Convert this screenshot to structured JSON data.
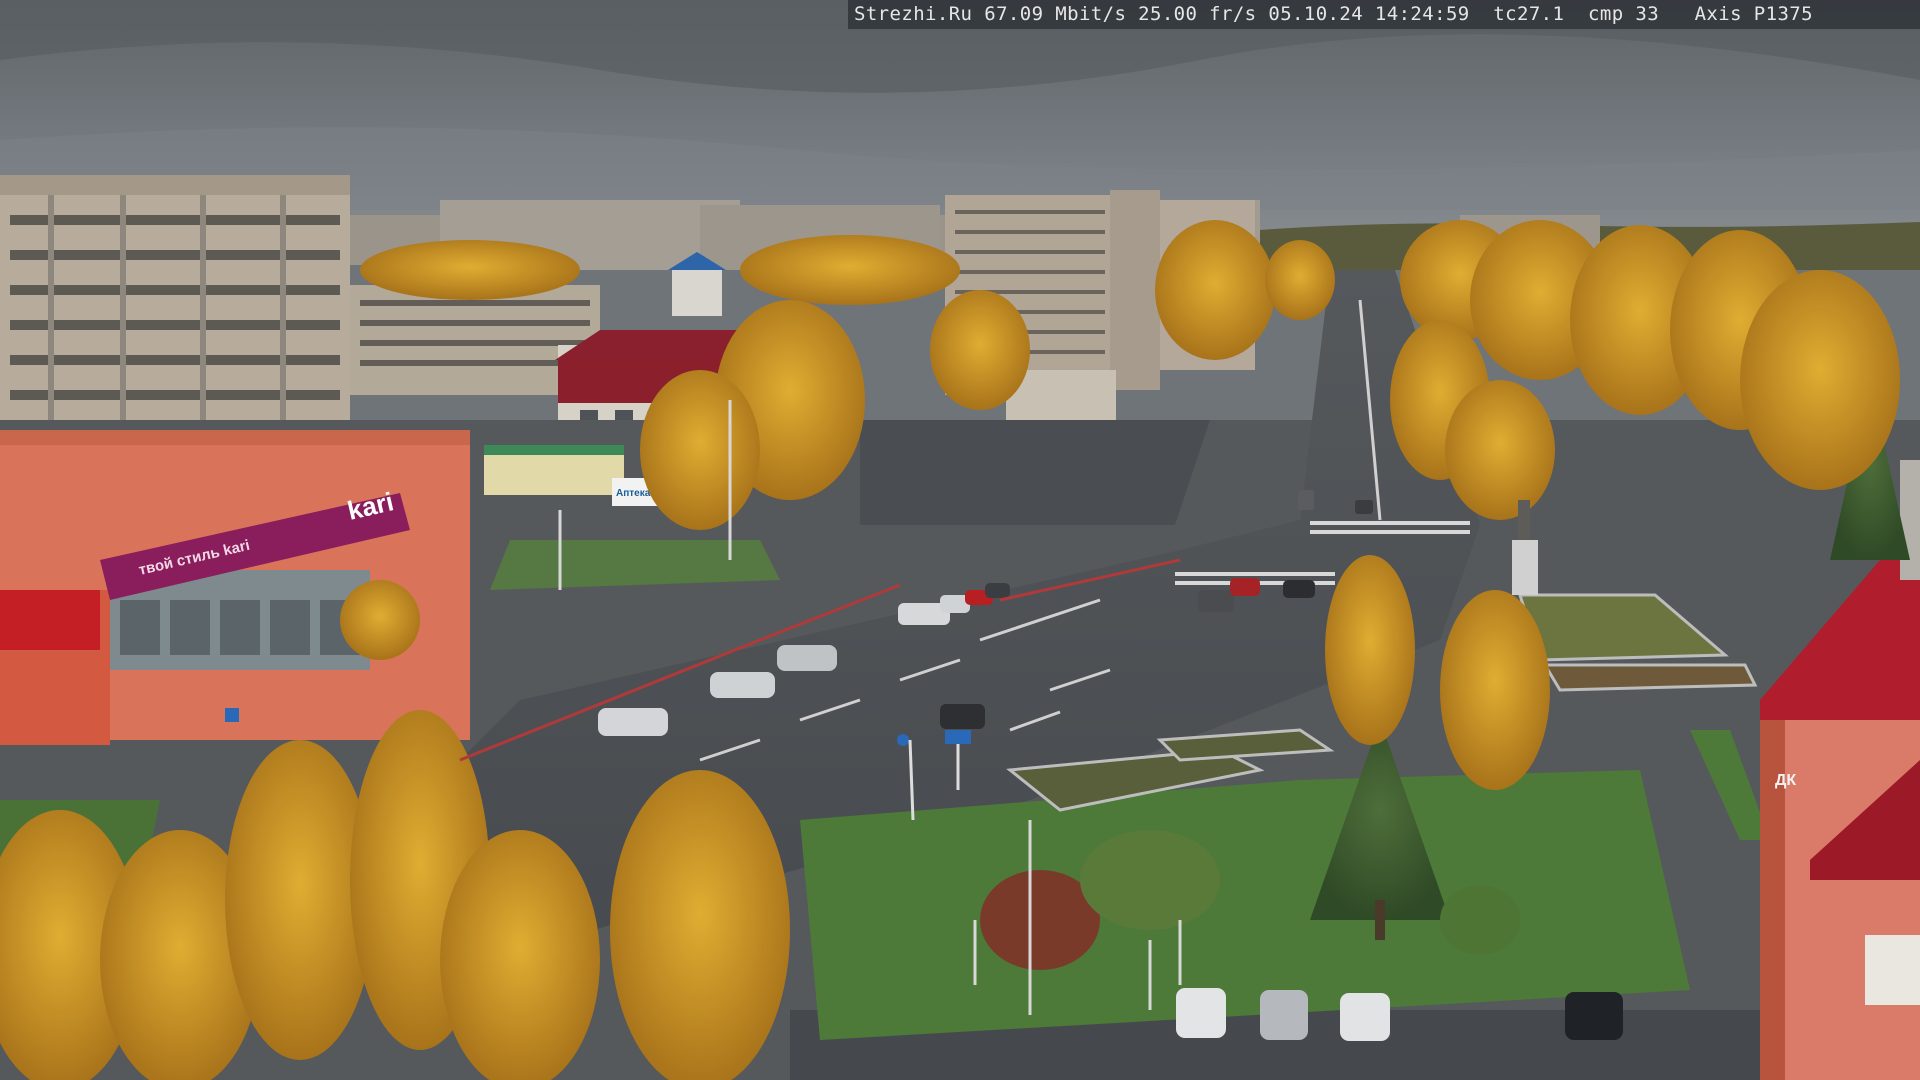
{
  "camera_overlay": {
    "text": "Strezhi.Ru 67.09 Mbit/s 25.00 fr/s 05.10.24 14:24:59  tc27.1  cmp 33   Axis P1375"
  },
  "signs": {
    "store_brand": "kari",
    "store_slogan": "твой стиль kari",
    "pharmacy_label": "Аптека",
    "tower_letters": "ДК"
  },
  "colors": {
    "sky": "#6f7479",
    "autumn_foliage": "#c9961f",
    "grass": "#4f7d3a",
    "asphalt": "#4b4f53",
    "store_facade": "#d9745a",
    "store_sign": "#8a1d5c",
    "roof_red": "#b01e2e",
    "osd_text": "#e6e6e6"
  }
}
